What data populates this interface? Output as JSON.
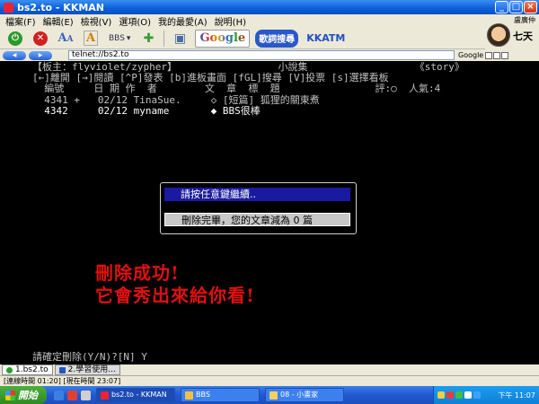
{
  "window": {
    "title": "bs2.to - KKMAN"
  },
  "menu": [
    "檔案(F)",
    "編輯(E)",
    "檢視(V)",
    "選項(O)",
    "我的最愛(A)",
    "說明(H)"
  ],
  "toolbar": {
    "bbs_label": "BBS",
    "google_label": "Google",
    "lyric_label": "歌詞搜尋",
    "kkatm_label": "KKATM"
  },
  "user": {
    "name": "盧廣仲",
    "tag": "七天"
  },
  "address": {
    "value": "telnet://bs2.to",
    "search_label": "Google"
  },
  "terminal": {
    "header": "【板主：flyviolet/zypher】                 小說集                  《story》",
    "help": "[←]離開 [→]閱讀 [^P]發表 [b]進板畫面 [fGL]搜尋 [V]投票 [s]選擇看板",
    "columns": "  編號     日 期 作  者        文  章  標  題                評:○  人氣:4",
    "rows": [
      "  4341 +   02/12 TinaSue.     ◇ [短篇] 狐狸的關東煮",
      "  4342     02/12 myname       ◆ BBS很棒"
    ],
    "prompt": "請確定刪除(Y/N)?[N] Y"
  },
  "dialog": {
    "title": "請按任意鍵繼續..",
    "message": "刪除完畢，您的文章減為 0 篇"
  },
  "overlay": {
    "line1": "刪除成功!",
    "line2": "它會秀出來給你看!"
  },
  "connection_tabs": [
    {
      "label": "1.bs2.to"
    },
    {
      "label": "2.學習使用..."
    }
  ],
  "status": {
    "text": "[連線時間 01:20] [現在時間 23:07]"
  },
  "taskbar": {
    "start_label": "開始",
    "tasks": [
      {
        "label": "bs2.to - KKMAN"
      },
      {
        "label": "BBS"
      },
      {
        "label": "08 - 小畫家"
      }
    ],
    "clock": "下午 11:07"
  }
}
